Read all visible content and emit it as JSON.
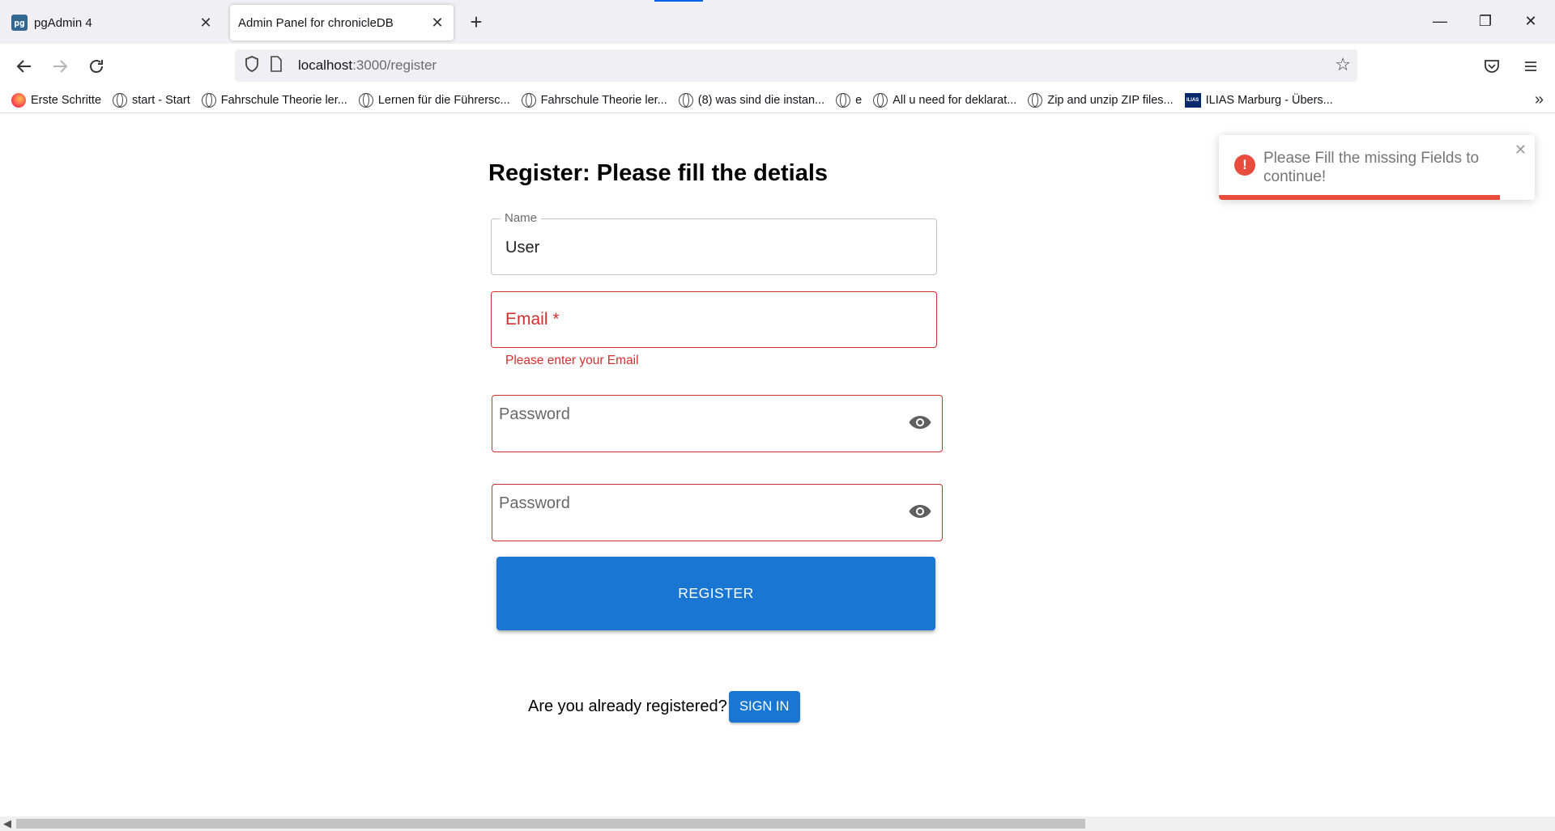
{
  "browser": {
    "tabs": [
      {
        "title": "pgAdmin 4",
        "favicon": "pg",
        "active": false
      },
      {
        "title": "Admin Panel for chronicleDB",
        "active": true
      }
    ],
    "url_host": "localhost",
    "url_path": ":3000/register",
    "bookmarks": [
      {
        "label": "Erste Schritte",
        "icon": "firefox-icon"
      },
      {
        "label": "start - Start",
        "icon": "globe-icon"
      },
      {
        "label": "Fahrschule Theorie ler...",
        "icon": "globe-icon"
      },
      {
        "label": "Lernen für die Führersc...",
        "icon": "globe-icon"
      },
      {
        "label": "Fahrschule Theorie ler...",
        "icon": "globe-icon"
      },
      {
        "label": "(8) was sind die instan...",
        "icon": "globe-icon"
      },
      {
        "label": "e",
        "icon": "globe-icon"
      },
      {
        "label": "All u need for deklarat...",
        "icon": "globe-icon"
      },
      {
        "label": "Zip and unzip ZIP files...",
        "icon": "globe-icon"
      },
      {
        "label": "ILIAS Marburg - Übers...",
        "icon": "ilias-icon",
        "icon_text": "ILIAS"
      }
    ]
  },
  "form": {
    "heading": "Register: Please fill the detials",
    "name_label": "Name",
    "name_value": "User",
    "email_label": "Email *",
    "email_helper": "Please enter your Email",
    "password_label": "Password",
    "confirm_password_label": "Password",
    "register_label": "REGISTER",
    "signin_prompt": "Are you already registered?",
    "signin_label": "SIGN IN"
  },
  "toast": {
    "message": "Please Fill the missing Fields to continue!",
    "progress_fraction": 0.89,
    "accent": "#e74c3c"
  },
  "colors": {
    "primary": "#1976d2",
    "error": "#d32f2f"
  }
}
